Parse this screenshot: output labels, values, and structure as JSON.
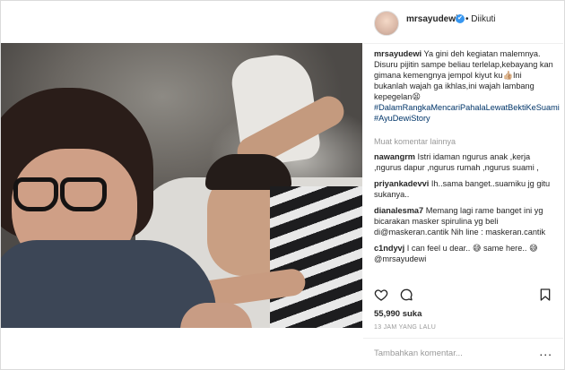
{
  "post": {
    "username": "mrsayudewi",
    "verified_mark": "✔",
    "follow_status": "• Diikuti"
  },
  "comments": {
    "caption": {
      "user": "mrsayudewi",
      "text": "Ya gini deh kegiatan malemnya. Disuru pijitin sampe beliau terlelap,kebayang kan gimana kemengnya jempol kiyut ku👍🏼Ini bukanlah wajah ga ikhlas,ini wajah lambang kepegelan😫",
      "tags": "#DalamRangkaMencariPahalaLewatBektiKeSuami #AyuDewiStory"
    },
    "load_more": "Muat komentar lainnya",
    "items": [
      {
        "user": "nawangrm",
        "text": "Istri idaman ngurus anak ,kerja ,ngurus dapur ,ngurus rumah ,ngurus suami ,"
      },
      {
        "user": "priyankadevvi",
        "text": "Ih..sama banget..suamiku jg gitu sukanya.."
      },
      {
        "user": "dianalesma7",
        "text": "Memang lagi rame banget ini yg bicarakan masker spirulina yg beli di@maskeran.cantik Nih line : maskeran.cantik"
      },
      {
        "user": "c1ndyvj",
        "text": "I can feel u dear.. 😅 same here.. 😅 @mrsayudewi"
      }
    ]
  },
  "actions": {
    "like_icon": "heart-outline-icon",
    "comment_icon": "speech-bubble-icon",
    "save_icon": "bookmark-icon"
  },
  "likes": "55,990 suka",
  "time": "13 JAM YANG LALU",
  "add_comment": {
    "placeholder": "Tambahkan komentar...",
    "more": "..."
  }
}
